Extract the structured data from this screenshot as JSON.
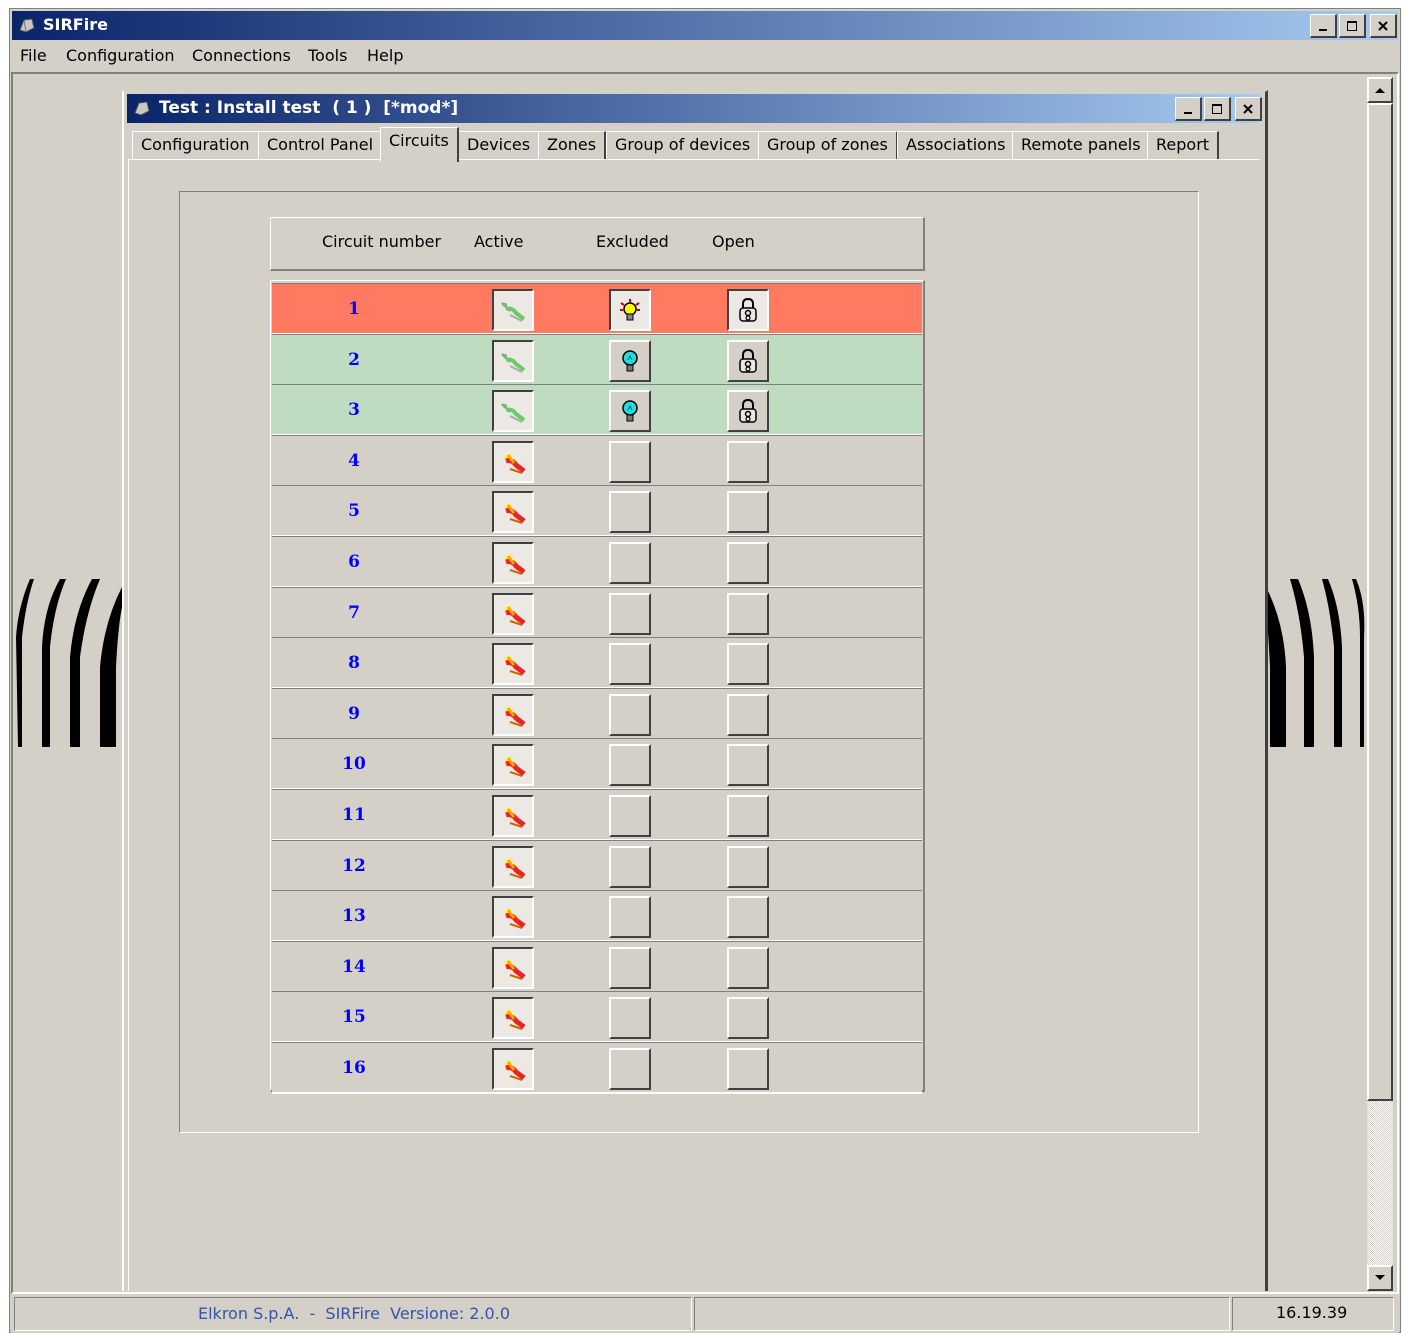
{
  "app": {
    "title": "SIRFire"
  },
  "menu": [
    "File",
    "Configuration",
    "Connections",
    "Tools",
    "Help"
  ],
  "child_window": {
    "title": "Test : Install test  ( 1 )  [*mod*]"
  },
  "tabs": [
    "Configuration",
    "Control Panel",
    "Circuits",
    "Devices",
    "Zones",
    "Group of devices",
    "Group of zones",
    "Associations",
    "Remote panels",
    "Report"
  ],
  "active_tab": "Circuits",
  "table": {
    "headers": [
      "Circuit number",
      "Active",
      "Excluded",
      "Open"
    ],
    "rows": [
      {
        "number": "1",
        "state": "alarm",
        "active": "wire-ok-icon",
        "excluded": "bulb-yellow-icon",
        "open": "lock-icon"
      },
      {
        "number": "2",
        "state": "ok",
        "active": "wire-ok-icon",
        "excluded": "bulb-cyan-icon",
        "open": "lock-icon"
      },
      {
        "number": "3",
        "state": "ok",
        "active": "wire-ok-icon",
        "excluded": "bulb-cyan-icon",
        "open": "lock-icon"
      },
      {
        "number": "4",
        "state": "inactive",
        "active": "wire-off-icon",
        "excluded": "",
        "open": ""
      },
      {
        "number": "5",
        "state": "inactive",
        "active": "wire-off-icon",
        "excluded": "",
        "open": ""
      },
      {
        "number": "6",
        "state": "inactive",
        "active": "wire-off-icon",
        "excluded": "",
        "open": ""
      },
      {
        "number": "7",
        "state": "inactive",
        "active": "wire-off-icon",
        "excluded": "",
        "open": ""
      },
      {
        "number": "8",
        "state": "inactive",
        "active": "wire-off-icon",
        "excluded": "",
        "open": ""
      },
      {
        "number": "9",
        "state": "inactive",
        "active": "wire-off-icon",
        "excluded": "",
        "open": ""
      },
      {
        "number": "10",
        "state": "inactive",
        "active": "wire-off-icon",
        "excluded": "",
        "open": ""
      },
      {
        "number": "11",
        "state": "inactive",
        "active": "wire-off-icon",
        "excluded": "",
        "open": ""
      },
      {
        "number": "12",
        "state": "inactive",
        "active": "wire-off-icon",
        "excluded": "",
        "open": ""
      },
      {
        "number": "13",
        "state": "inactive",
        "active": "wire-off-icon",
        "excluded": "",
        "open": ""
      },
      {
        "number": "14",
        "state": "inactive",
        "active": "wire-off-icon",
        "excluded": "",
        "open": ""
      },
      {
        "number": "15",
        "state": "inactive",
        "active": "wire-off-icon",
        "excluded": "",
        "open": ""
      },
      {
        "number": "16",
        "state": "inactive",
        "active": "wire-off-icon",
        "excluded": "",
        "open": ""
      }
    ]
  },
  "status_bar": {
    "left": "Elkron S.p.A.  -  SIRFire  Versione: 2.0.0",
    "middle": "",
    "time": "16.19.39"
  },
  "colors": {
    "title_gradient_start": "#0a246a",
    "title_gradient_end": "#a6caf0",
    "row_alarm": "#ff7a60",
    "row_ok": "#c0dcc0",
    "face": "#d4d0c8",
    "number_text": "#0000ff"
  }
}
